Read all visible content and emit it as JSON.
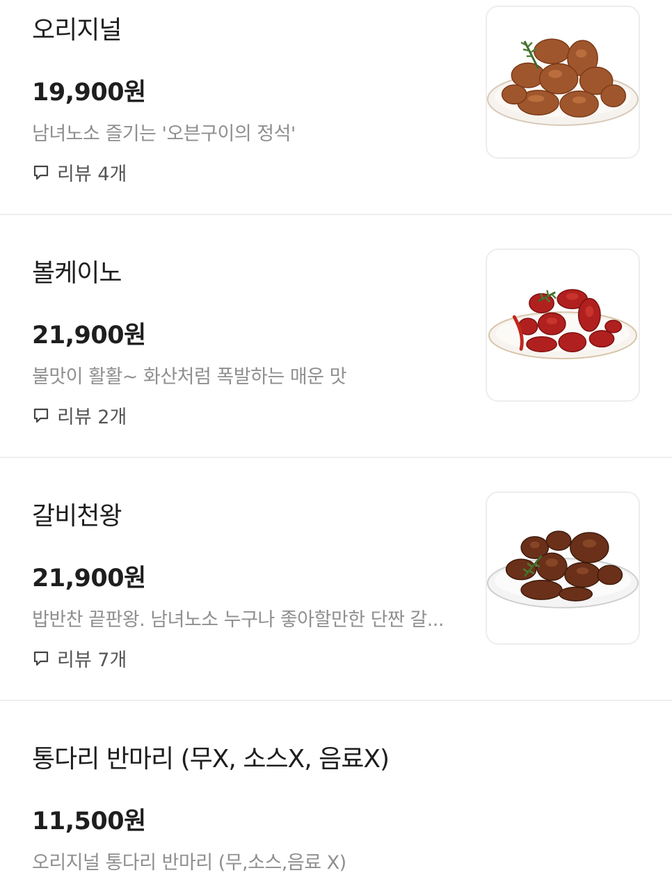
{
  "menu": {
    "items": [
      {
        "name": "오리지널",
        "price": "19,900원",
        "description": "남녀노소 즐기는 '오븐구이의 정석'",
        "review_label": "리뷰 4개",
        "image_icon": "roasted-chicken-plate-image"
      },
      {
        "name": "볼케이노",
        "price": "21,900원",
        "description": "불맛이 활활~ 화산처럼 폭발하는 매운 맛",
        "review_label": "리뷰 2개",
        "image_icon": "spicy-red-chicken-plate-image"
      },
      {
        "name": "갈비천왕",
        "price": "21,900원",
        "description": "밥반찬 끝판왕. 남녀노소 누구나 좋아할만한 단짠 갈...",
        "review_label": "리뷰 7개",
        "image_icon": "galbi-glazed-chicken-plate-image"
      },
      {
        "name": "통다리 반마리 (무X, 소스X, 음료X)",
        "price": "11,500원",
        "description": "오리지널 통다리 반마리 (무,소스,음료 X)"
      }
    ]
  },
  "colors": {
    "text_primary": "#1e1e1e",
    "text_secondary": "#8f8f8f",
    "divider": "#eeeeee",
    "original_chicken": "#a0562c",
    "volcano_chicken": "#b0201e",
    "galbi_chicken": "#6a3019"
  }
}
